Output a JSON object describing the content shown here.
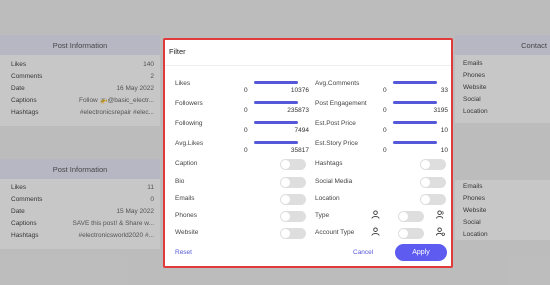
{
  "background": {
    "card1": {
      "header": "Post Information",
      "rows": [
        {
          "label": "Likes",
          "value": "140"
        },
        {
          "label": "Comments",
          "value": "2"
        },
        {
          "label": "Date",
          "value": "16 May 2022"
        },
        {
          "label": "Captions",
          "value": "Follow 🚁@basic_electr..."
        },
        {
          "label": "Hashtags",
          "value": "#electronicsrepair #elec..."
        }
      ]
    },
    "card2": {
      "header": "Post Information",
      "rows": [
        {
          "label": "Likes",
          "value": "11"
        },
        {
          "label": "Comments",
          "value": "0"
        },
        {
          "label": "Date",
          "value": "15 May 2022"
        },
        {
          "label": "Captions",
          "value": "SAVE this post! & Share w..."
        },
        {
          "label": "Hashtags",
          "value": "#electronicsworld2020 #..."
        }
      ]
    },
    "right1": {
      "header": "Contact",
      "items": [
        "Emails",
        "Phones",
        "Website",
        "Social",
        "Location"
      ]
    },
    "right2": {
      "items": [
        "Emails",
        "Phones",
        "Website",
        "Social",
        "Location"
      ]
    }
  },
  "modal": {
    "title": "Filter",
    "left_sliders": [
      {
        "label": "Likes",
        "min": "0",
        "max": "10376"
      },
      {
        "label": "Followers",
        "min": "0",
        "max": "235873"
      },
      {
        "label": "Following",
        "min": "0",
        "max": "7494"
      },
      {
        "label": "Avg.Likes",
        "min": "0",
        "max": "35817"
      }
    ],
    "right_sliders": [
      {
        "label": "Avg.Comments",
        "min": "0",
        "max": "33"
      },
      {
        "label": "Post Engagement",
        "min": "0",
        "max": "3195"
      },
      {
        "label": "Est.Post Price",
        "min": "0",
        "max": "10"
      },
      {
        "label": "Est.Story Price",
        "min": "0",
        "max": "10"
      }
    ],
    "left_toggles": [
      "Caption",
      "Bio",
      "Emails",
      "Phones",
      "Website"
    ],
    "right_toggles": [
      "Hashtags",
      "Social Media",
      "Location",
      "Type",
      "Account Type"
    ],
    "reset_label": "Reset",
    "cancel_label": "Cancel",
    "apply_label": "Apply",
    "accent_color": "#5e5cf0",
    "border_color": "#e03a3a"
  }
}
